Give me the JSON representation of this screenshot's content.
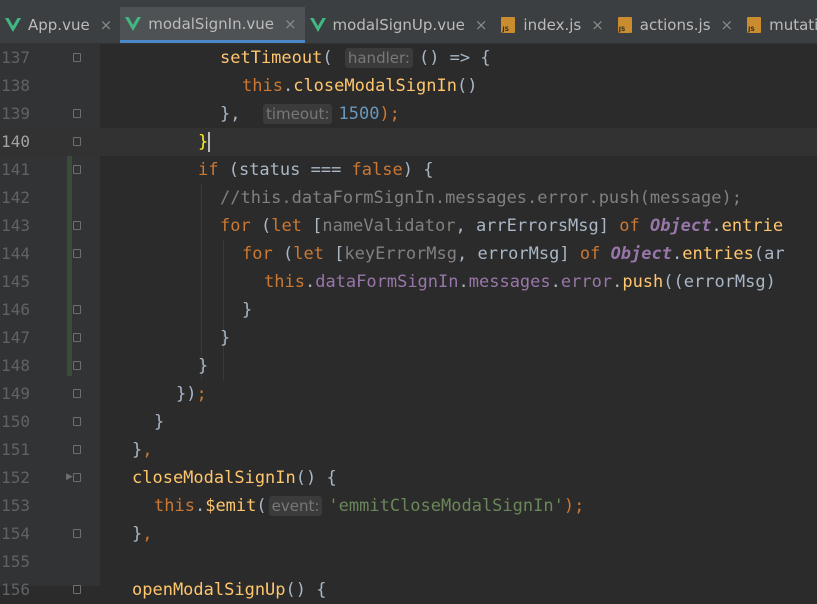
{
  "tabs": [
    {
      "label": "App.vue",
      "icon": "vue-icon",
      "active": false
    },
    {
      "label": "modalSignIn.vue",
      "icon": "vue-icon",
      "active": true
    },
    {
      "label": "modalSignUp.vue",
      "icon": "vue-icon",
      "active": false
    },
    {
      "label": "index.js",
      "icon": "js-icon",
      "active": false
    },
    {
      "label": "actions.js",
      "icon": "js-icon",
      "active": false
    },
    {
      "label": "mutations.js",
      "icon": "js-icon",
      "active": false
    }
  ],
  "tab_close_symbol": "×",
  "js_icon_text": "JS",
  "code": {
    "current_line": "140",
    "lines": [
      {
        "num": "137"
      },
      {
        "num": "138"
      },
      {
        "num": "139"
      },
      {
        "num": "140"
      },
      {
        "num": "141"
      },
      {
        "num": "142"
      },
      {
        "num": "143"
      },
      {
        "num": "144"
      },
      {
        "num": "145"
      },
      {
        "num": "146"
      },
      {
        "num": "147"
      },
      {
        "num": "148"
      },
      {
        "num": "149"
      },
      {
        "num": "150"
      },
      {
        "num": "151"
      },
      {
        "num": "152"
      },
      {
        "num": "153"
      },
      {
        "num": "154"
      },
      {
        "num": "155"
      },
      {
        "num": "156"
      }
    ],
    "text": {
      "l137_fn": "setTimeout",
      "l137_open": "(",
      "l137_hint": "handler:",
      "l137_arrow": "() => {",
      "l138_this": "this",
      "l138_call": "closeModalSignIn",
      "l138_paren": "()",
      "l139_close": "},",
      "l139_hint": "timeout:",
      "l139_num": "1500",
      "l139_end": ");",
      "l140_brace": "}",
      "l141_kw": "if",
      "l141_a": " (status === ",
      "l141_false": "false",
      "l141_b": ") {",
      "l142_comment": "//this.dataFormSignIn.messages.error.push(message);",
      "l143_for": "for",
      "l143_a": " (",
      "l143_let": "let",
      "l143_b": " [",
      "l143_v1": "nameValidator",
      "l143_c": ", arrErrorsMsg] ",
      "l143_of": "of",
      "l143_obj": "Object",
      "l143_dot": ".",
      "l143_entries": "entrie",
      "l144_for": "for",
      "l144_a": " (",
      "l144_let": "let",
      "l144_b": " [",
      "l144_v1": "keyErrorMsg",
      "l144_c": ", errorMsg] ",
      "l144_of": "of",
      "l144_obj": "Object",
      "l144_dot": ".",
      "l144_entries": "entries",
      "l144_tail": "(ar",
      "l145_this": "this",
      "l145_d1": ".",
      "l145_p1": "dataFormSignIn",
      "l145_d2": ".",
      "l145_p2": "messages",
      "l145_d3": ".",
      "l145_p3": "error",
      "l145_d4": ".",
      "l145_push": "push",
      "l145_tail": "((errorMsg)",
      "l146": "}",
      "l147": "}",
      "l148": "}",
      "l149_a": "})",
      "l149_semi": ";",
      "l150": "}",
      "l151_a": "}",
      "l151_comma": ",",
      "l152_fn": "closeModalSignIn",
      "l152_b": "() {",
      "l153_this": "this",
      "l153_dot": ".",
      "l153_emit": "$emit",
      "l153_open": "(",
      "l153_hint": "event:",
      "l153_str": "'emmitCloseModalSignIn'",
      "l153_end": ");",
      "l154_a": "}",
      "l154_comma": ",",
      "l156_fn": "openModalSignUp",
      "l156_b": "() {"
    }
  },
  "colors": {
    "background": "#2b2b2b",
    "gutter": "#313335",
    "keyword": "#cc7832",
    "function": "#ffc66d",
    "property": "#9876aa",
    "string": "#6a8759",
    "number": "#6897bb",
    "comment": "#808080",
    "active_tab_underline": "#4a88c7"
  }
}
